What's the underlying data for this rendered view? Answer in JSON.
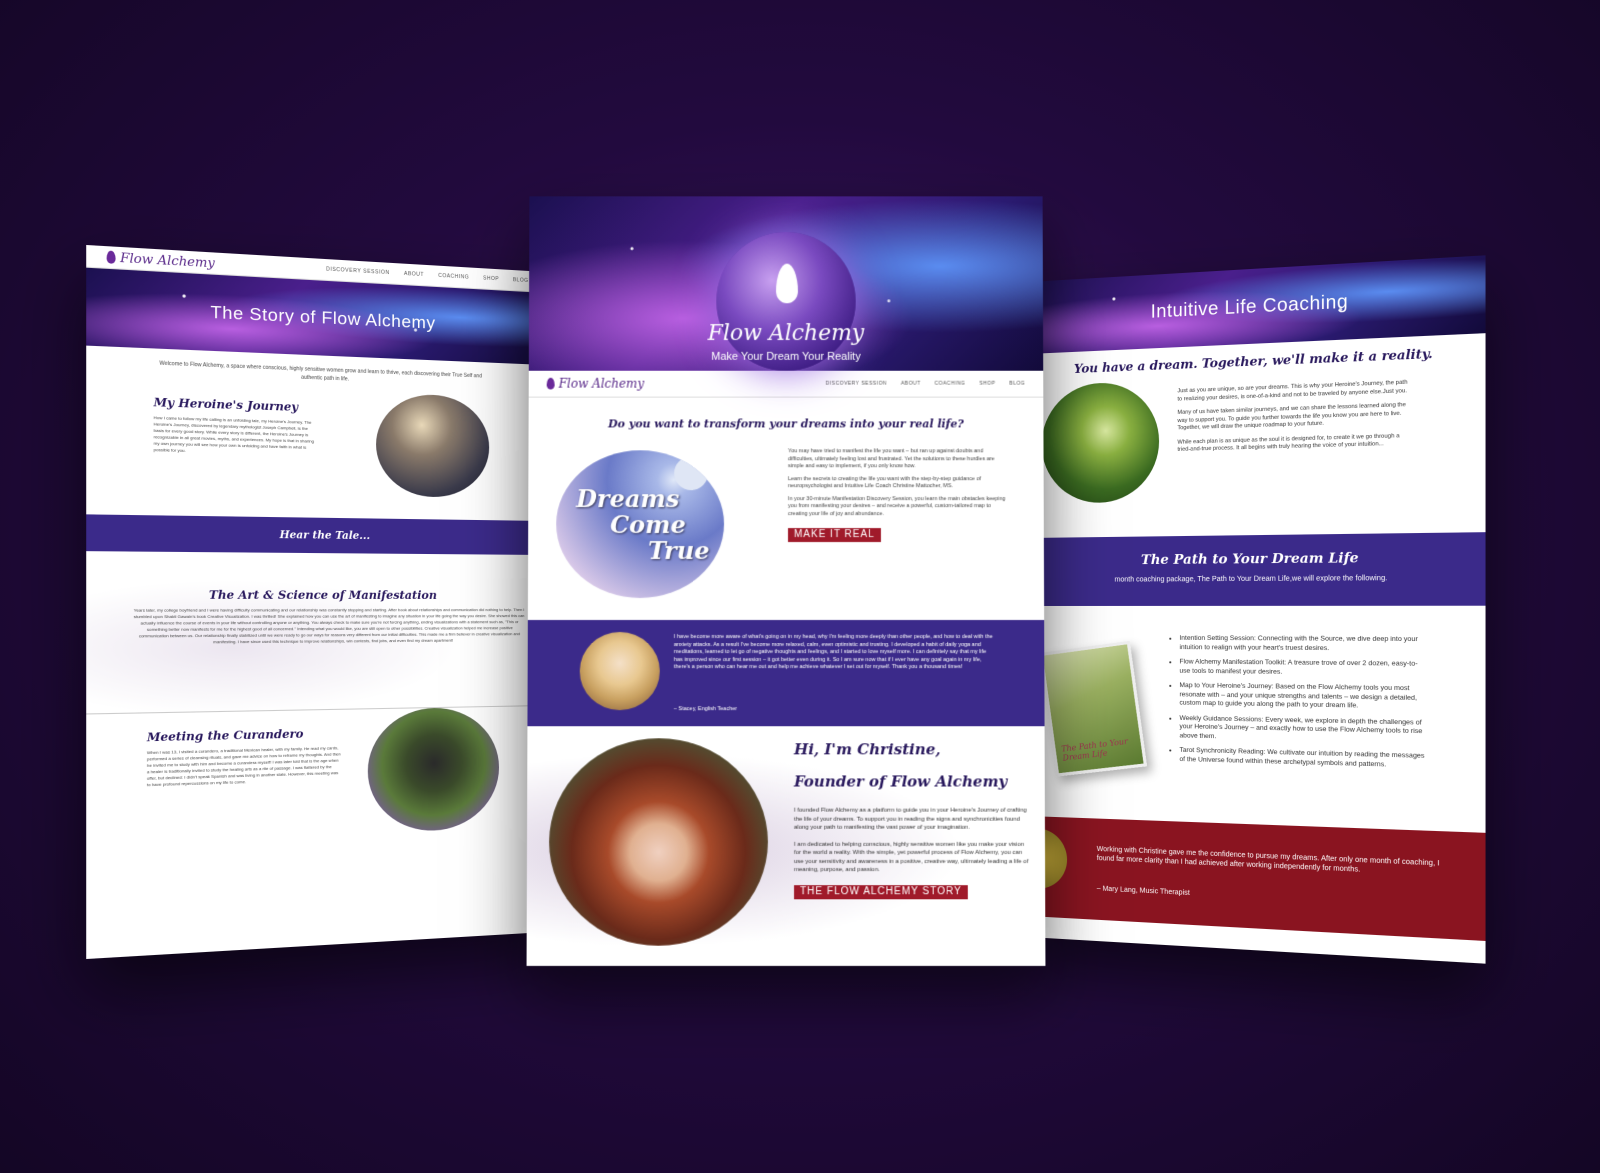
{
  "left_page": {
    "logo": "Flow Alchemy",
    "nav": [
      "DISCOVERY SESSION",
      "ABOUT",
      "COACHING",
      "SHOP",
      "BLOG"
    ],
    "hero_title": "The Story of Flow Alchemy",
    "intro": "Welcome to Flow Alchemy, a space where conscious, highly sensitive women grow and learn to thrive, each discovering their True Self and authentic path in life.",
    "section1_title": "My Heroine's Journey",
    "section1_text": "How I came to follow my life calling is an unfolding tale, my Heroine's Journey. The Heroine's Journey, discovered by legendary mythologist Joseph Campbell, is the basis for every good story. While every story is different, the Heroine's Journey is recognizable in all great movies, myths, and experiences. My hope is that in sharing my own journey you will see how your own is unfolding and have faith in what is possible for you.",
    "band_label": "Hear the Tale...",
    "section2_title": "The Art & Science of Manifestation",
    "section2_text": "Years later, my college boyfriend and I were having difficulty communicating and our relationship was constantly stopping and starting. After book about relationships and communication did nothing to help. Then I stumbled upon Shakti Gawain's book Creative Visualization. I was thrilled! She explained how you can use the art of manifesting to imagine any situation in your life going the way you desire. She showed this can actually influence the course of events in your life without controlling anyone or anything. You always check to make sure you're not forcing anything, ending visualizations with a statement such as, \"This or something better now manifests for me for the highest good of all concerned.\" Intending what you would like, you are still open to other possibilities. Creative visualization helped me increase positive communication between us. Our relationship finally stabilized until we were ready to go our ways for reasons very different from our initial difficulties. This made me a firm believer in creative visualization and manifesting. I have since used this technique to improve relationships, win contests, find jobs, and even find my dream apartment!",
    "section3_title": "Meeting the Curandero",
    "section3_text": "When I was 13, I visited a curandero, a traditional Mexican healer, with my family. He read my cards, performed a series of cleansing rituals, and gave me advice on how to reframe my thoughts. And then he invited me to study with him and become a curandera myself! I was later told that is the age when a healer is traditionally invited to study the healing arts as a rite of passage. I was flattered by the offer, but declined: I didn't speak Spanish and was living in another state. However, this meeting was to have profound repercussions on my life to come."
  },
  "center_page": {
    "hero_logo": "Flow Alchemy",
    "hero_tagline": "Make Your Dream Your Reality",
    "logo": "Flow Alchemy",
    "nav": [
      "DISCOVERY SESSION",
      "ABOUT",
      "COACHING",
      "SHOP",
      "BLOG"
    ],
    "headline": "Do you want to transform your dreams into your real life?",
    "dreams_line1": "Dreams",
    "dreams_line2": "Come",
    "dreams_line3": "True",
    "para1": "You may have tried to manifest the life you want – but ran up against doubts and difficulties, ultimately feeling lost and frustrated. Yet the solutions to these hurdles are simple and easy to implement, if you only know how.",
    "para2": "Learn the secrets to creating the life you want with the step-by-step guidance of neuropsychologist and Intuitive Life Coach Christine Mattocher, MS.",
    "para3": "In your 30-minute Manifestation Discovery Session, you learn the main obstacles keeping you from manifesting your desires – and receive a powerful, custom-tailored map to creating your life of joy and abundance.",
    "cta": "MAKE IT REAL",
    "testimonial": "I have become more aware of what's going on in my head, why I'm feeling more deeply than other people, and how to deal with the anxiety attacks. As a result I've become more relaxed, calm, even optimistic and trusting. I developed a habit of daily yoga and meditations, learned to let go of negative thoughts and feelings, and I started to love myself more. I can definitely say that my life has improved since our first session – it got better even during it. So I am sure now that if I ever have any goal again in my life, there's a person who can hear me out and help me achieve whatever I set out for myself. Thank you a thousand times!",
    "testimonial_author": "– Stacey, English Teacher",
    "founder_line1": "Hi, I'm Christine,",
    "founder_line2": "Founder of Flow Alchemy",
    "founder_para1": "I founded Flow Alchemy as a platform to guide you in your Heroine's Journey of crafting the life of your dreams. To support you in reading the signs and synchronicities found along your path to manifesting the vast power of your imagination.",
    "founder_para2": "I am dedicated to helping conscious, highly sensitive women like you make your vision for the world a reality. With the simple, yet powerful process of Flow Alchemy, you can use your sensitivity and awareness in a positive, creative way, ultimately leading a life of meaning, purpose, and passion.",
    "founder_cta": "THE FLOW ALCHEMY STORY"
  },
  "right_page": {
    "hero_title": "Intuitive Life Coaching",
    "headline": "You have a dream. Together, we'll make it a reality.",
    "para1": "Just as you are unique, so are your dreams. This is why your Heroine's Journey, the path to realizing your desires, is one-of-a-kind and not to be traveled by anyone else.Just you.",
    "para2": "Many of us have taken similar journeys, and we can share the lessons learned along the way to support you. To guide you further towards the life you know you are here to live. Together, we will draw the unique roadmap to your future.",
    "para3": "While each plan is as unique as the soul it is designed for, to create it we go through a tried-and-true process. It all begins with truly hearing the voice of your intuition...",
    "band_title": "The Path to Your Dream Life",
    "band_sub": "month coaching package, The Path to Your Dream Life,we will explore the following.",
    "book_title": "The Path to Your Dream Life",
    "bullets": [
      "Intention Setting Session: Connecting with the Source, we dive deep into your intuition to realign with your heart's truest desires.",
      "Flow Alchemy Manifestation Toolkit: A treasure trove of over 2 dozen, easy-to-use tools to manifest your desires.",
      "Map to Your Heroine's Journey: Based on the Flow Alchemy tools you most resonate with – and your unique strengths and talents – we design a detailed, custom map to guide you along the path to your dream life.",
      "Weekly Guidance Sessions: Every week, we explore in depth the challenges of your Heroine's Journey – and exactly how to use the Flow Alchemy tools to rise above them.",
      "Tarot Synchronicity Reading: We cultivate our intuition by reading the messages of the Universe found within these archetypal symbols and patterns."
    ],
    "testimonial": "Working with Christine gave me the confidence to pursue my dreams. After only one month of coaching, I found far more clarity than I had achieved after working independently for months.",
    "testimonial_author": "– Mary Lang, Music Therapist"
  },
  "colors": {
    "background": "#220a3e",
    "band_purple": "#3b2a8a",
    "accent_red": "#a01a2a",
    "heading_navy": "#2a1a5e"
  }
}
